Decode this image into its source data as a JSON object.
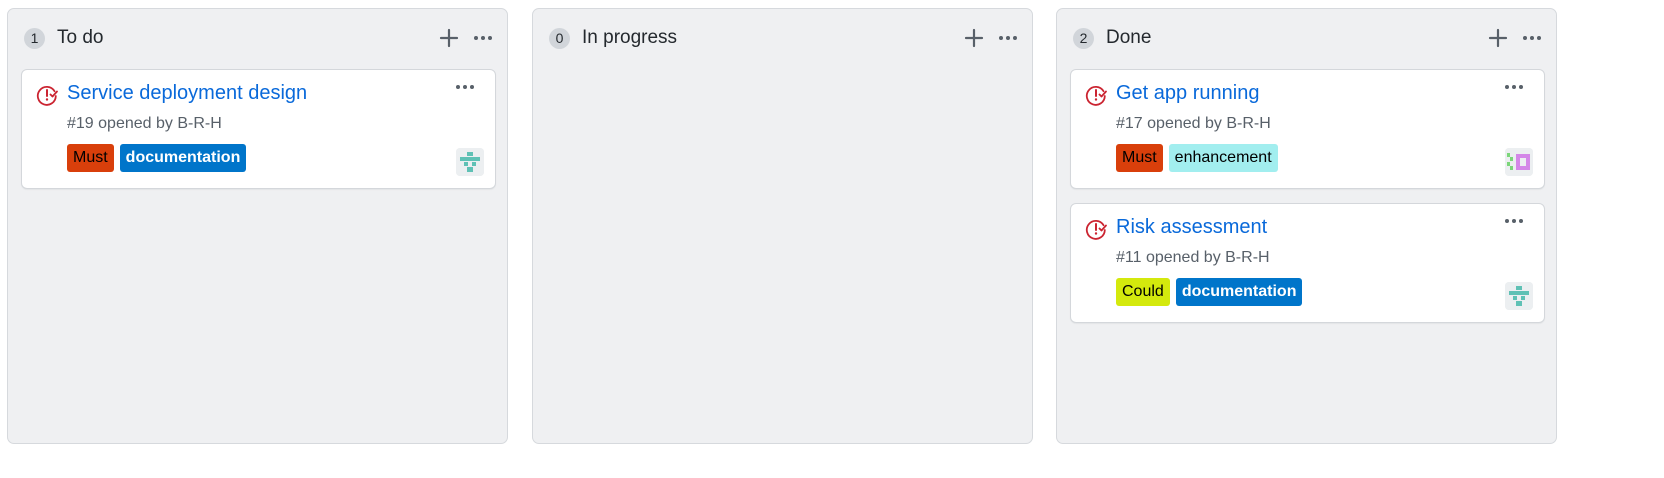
{
  "columns": [
    {
      "title": "To do",
      "count": "1",
      "cards": [
        {
          "title": "Service deployment design",
          "meta": "#19 opened by B-R-H",
          "labels": [
            {
              "text": "Must",
              "bg": "#d93f0b",
              "fg": "#000000"
            },
            {
              "text": "documentation",
              "bg": "#0075ca",
              "fg": "#ffffff"
            }
          ],
          "avatar_icon": "identicon-teal"
        }
      ]
    },
    {
      "title": "In progress",
      "count": "0",
      "cards": []
    },
    {
      "title": "Done",
      "count": "2",
      "cards": [
        {
          "title": "Get app running",
          "meta": "#17 opened by B-R-H",
          "labels": [
            {
              "text": "Must",
              "bg": "#d93f0b",
              "fg": "#000000"
            },
            {
              "text": "enhancement",
              "bg": "#a2eeef",
              "fg": "#000000"
            }
          ],
          "avatar_icon": "identicon-green-purple"
        },
        {
          "title": "Risk assessment",
          "meta": "#11 opened by B-R-H",
          "labels": [
            {
              "text": "Could",
              "bg": "#d4e90d",
              "fg": "#000000"
            },
            {
              "text": "documentation",
              "bg": "#0075ca",
              "fg": "#ffffff"
            }
          ],
          "avatar_icon": "identicon-teal"
        }
      ]
    }
  ],
  "colors": {
    "closed_issue_icon": "#cb2431",
    "link": "#0969da",
    "column_bg": "#eff0f2"
  },
  "icons": {
    "add": "plus-icon",
    "menu": "kebab-horizontal-icon",
    "issue_status": "issue-closed-icon"
  }
}
